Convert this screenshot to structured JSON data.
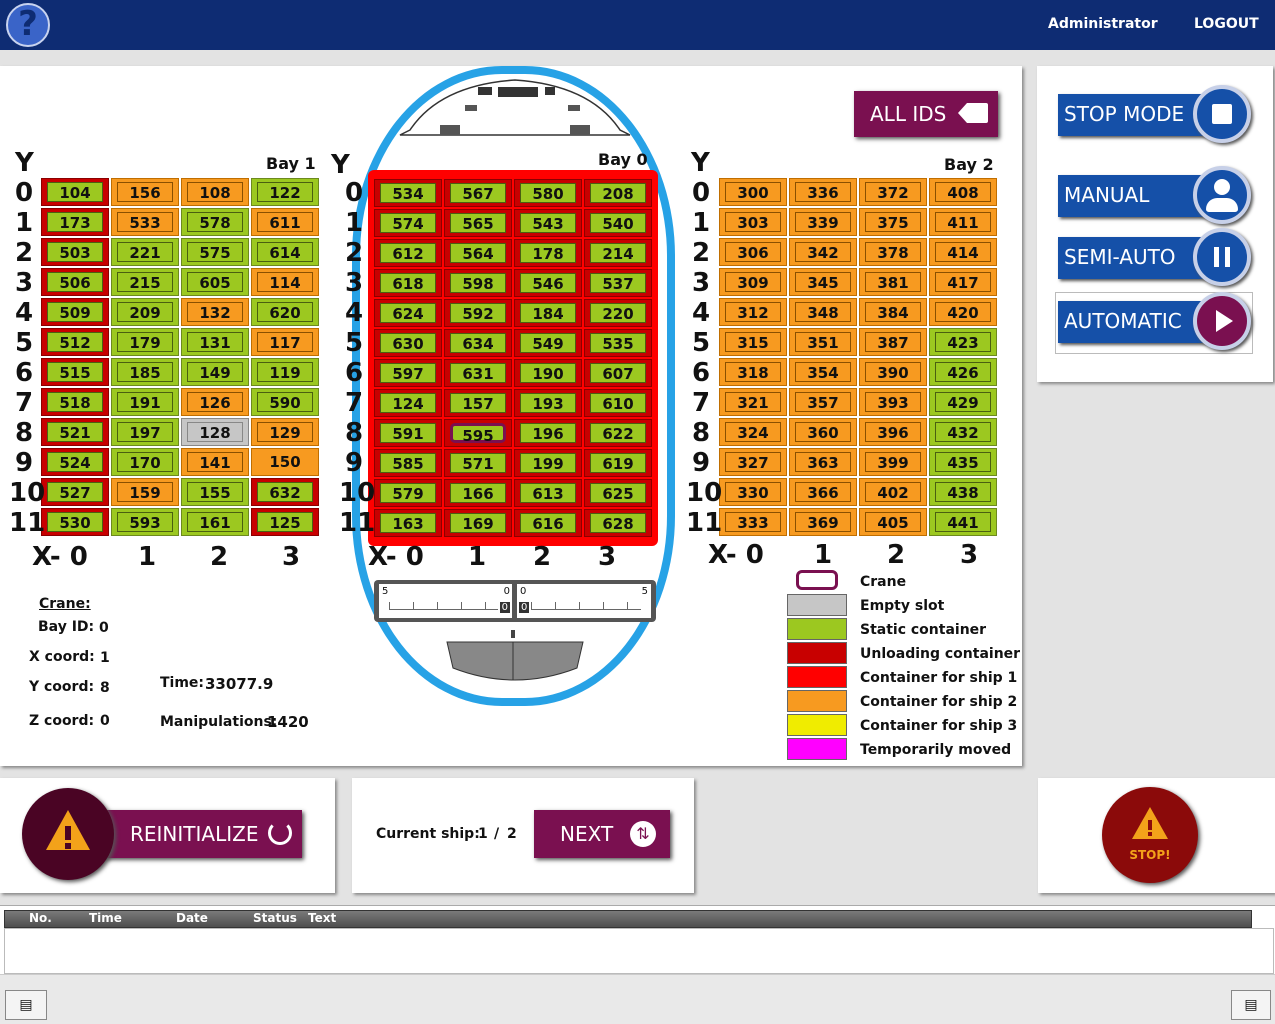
{
  "header": {
    "user": "Administrator",
    "logout": "LOGOUT",
    "help_icon": "help-icon"
  },
  "buttons": {
    "all_ids": "ALL IDS",
    "stop_mode": "STOP MODE",
    "manual": "MANUAL",
    "semi_auto": "SEMI-AUTO",
    "automatic": "AUTOMATIC",
    "reinitialize": "REINITIALIZE",
    "next": "NEXT",
    "stop": "STOP!"
  },
  "bays": [
    {
      "label": "Bay 1",
      "y_label": "Y",
      "x_labels": [
        "X- 0",
        "1",
        "2",
        "3"
      ],
      "rows": [
        [
          "104",
          "156",
          "108",
          "122"
        ],
        [
          "173",
          "533",
          "578",
          "611"
        ],
        [
          "503",
          "221",
          "575",
          "614"
        ],
        [
          "506",
          "215",
          "605",
          "114"
        ],
        [
          "509",
          "209",
          "132",
          "620"
        ],
        [
          "512",
          "179",
          "131",
          "117"
        ],
        [
          "515",
          "185",
          "149",
          "119"
        ],
        [
          "518",
          "191",
          "126",
          "590"
        ],
        [
          "521",
          "197",
          "128",
          "129"
        ],
        [
          "524",
          "170",
          "141",
          "150"
        ],
        [
          "527",
          "159",
          "155",
          "632"
        ],
        [
          "530",
          "593",
          "161",
          "125"
        ]
      ],
      "types": [
        [
          "red",
          "orange",
          "orange",
          "green"
        ],
        [
          "red",
          "orange",
          "green",
          "orange"
        ],
        [
          "red",
          "green",
          "green",
          "green"
        ],
        [
          "red",
          "green",
          "green",
          "orange"
        ],
        [
          "red",
          "green",
          "orange",
          "green"
        ],
        [
          "red",
          "green",
          "green",
          "orange"
        ],
        [
          "red",
          "green",
          "green",
          "green"
        ],
        [
          "red",
          "green",
          "orange",
          "green"
        ],
        [
          "red",
          "green",
          "empty",
          "orange"
        ],
        [
          "red",
          "green",
          "orange",
          "orangefull"
        ],
        [
          "red",
          "orange",
          "green",
          "red"
        ],
        [
          "red",
          "green",
          "green",
          "red"
        ]
      ]
    },
    {
      "label": "Bay 0",
      "y_label": "Y",
      "x_labels": [
        "X- 0",
        "1",
        "2",
        "3"
      ],
      "rows": [
        [
          "534",
          "567",
          "580",
          "208"
        ],
        [
          "574",
          "565",
          "543",
          "540"
        ],
        [
          "612",
          "564",
          "178",
          "214"
        ],
        [
          "618",
          "598",
          "546",
          "537"
        ],
        [
          "624",
          "592",
          "184",
          "220"
        ],
        [
          "630",
          "634",
          "549",
          "535"
        ],
        [
          "597",
          "631",
          "190",
          "607"
        ],
        [
          "124",
          "157",
          "193",
          "610"
        ],
        [
          "591",
          "595",
          "196",
          "622"
        ],
        [
          "585",
          "571",
          "199",
          "619"
        ],
        [
          "579",
          "166",
          "613",
          "625"
        ],
        [
          "163",
          "169",
          "616",
          "628"
        ]
      ]
    },
    {
      "label": "Bay 2",
      "y_label": "Y",
      "x_labels": [
        "X- 0",
        "1",
        "2",
        "3"
      ],
      "rows": [
        [
          "300",
          "336",
          "372",
          "408"
        ],
        [
          "303",
          "339",
          "375",
          "411"
        ],
        [
          "306",
          "342",
          "378",
          "414"
        ],
        [
          "309",
          "345",
          "381",
          "417"
        ],
        [
          "312",
          "348",
          "384",
          "420"
        ],
        [
          "315",
          "351",
          "387",
          "423"
        ],
        [
          "318",
          "354",
          "390",
          "426"
        ],
        [
          "321",
          "357",
          "393",
          "429"
        ],
        [
          "324",
          "360",
          "396",
          "432"
        ],
        [
          "327",
          "363",
          "399",
          "435"
        ],
        [
          "330",
          "366",
          "402",
          "438"
        ],
        [
          "333",
          "369",
          "405",
          "441"
        ]
      ]
    }
  ],
  "row_labels": [
    "0",
    "1",
    "2",
    "3",
    "4",
    "5",
    "6",
    "7",
    "8",
    "9",
    "10",
    "11"
  ],
  "crane": {
    "title": "Crane:",
    "bay_label": "Bay ID:",
    "bay": "0",
    "x_label": "X coord:",
    "x": "1",
    "y_label": "Y coord:",
    "y": "8",
    "z_label": "Z coord:",
    "z": "0"
  },
  "time": {
    "label": "Time:",
    "value": "33077.9"
  },
  "manipulations": {
    "label": "Manipulations:",
    "value": "1420"
  },
  "gauge": {
    "left": [
      "5",
      "0",
      "0"
    ],
    "right": [
      "0",
      "0",
      "5"
    ]
  },
  "legend": [
    {
      "label": "Crane",
      "color": "#ffffff"
    },
    {
      "label": "Empty slot",
      "color": "#c6c6c6"
    },
    {
      "label": "Static container",
      "color": "#9cc820"
    },
    {
      "label": "Unloading container",
      "color": "#c80000"
    },
    {
      "label": "Container for ship 1",
      "color": "#ff0000"
    },
    {
      "label": "Container for ship 2",
      "color": "#f79a20"
    },
    {
      "label": "Container for ship 3",
      "color": "#f0ec00"
    },
    {
      "label": "Temporarily moved",
      "color": "#ff00ff"
    }
  ],
  "ship": {
    "label": "Current ship:",
    "current": "1",
    "sep": "/",
    "total": "2"
  },
  "log": {
    "columns": [
      "No.",
      "Time",
      "Date",
      "Status",
      "Text"
    ]
  }
}
